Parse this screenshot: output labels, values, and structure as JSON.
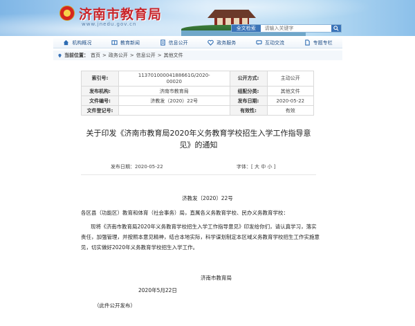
{
  "header": {
    "site_title": "济南市教育局",
    "site_domain": "www.jnedu.gov.cn",
    "search_label": "全文检索",
    "search_placeholder": "请输入关键字"
  },
  "nav": {
    "items": [
      {
        "label": "机构概况",
        "icon": "home-icon"
      },
      {
        "label": "教育新闻",
        "icon": "book-icon"
      },
      {
        "label": "信息公开",
        "icon": "document-icon"
      },
      {
        "label": "政务服务",
        "icon": "heart-icon"
      },
      {
        "label": "互动交流",
        "icon": "chat-icon"
      },
      {
        "label": "专题专栏",
        "icon": "file-icon"
      }
    ]
  },
  "breadcrumb": {
    "prefix": "当前位置：",
    "items": [
      "首页",
      "政务公开",
      "信息公开",
      "其他文件"
    ],
    "separator": ">"
  },
  "meta": {
    "index_label": "索引号:",
    "index_value_1": "11370100004188661G/2020-",
    "index_value_2": "00020",
    "open_mode_label": "公开方式:",
    "open_mode_value": "主动公开",
    "issuer_label": "发布机构:",
    "issuer_value": "济南市教育局",
    "category_label": "组配分类:",
    "category_value": "其他文件",
    "doc_no_label": "文件编号:",
    "doc_no_value": "济教发（2020）22号",
    "date_label": "发布日期:",
    "date_value": "2020-05-22",
    "reg_label": "文件登记号:",
    "reg_value": "",
    "validity_label": "有效性:",
    "validity_value": "有效"
  },
  "article": {
    "title_line1": "关于印发《济南市教育局2020年义务教育学校招生入学工作指导意",
    "title_line2": "见》的通知",
    "pub_date_label": "发布日期：",
    "pub_date": "2020-05-22",
    "font_label": "字体：[",
    "font_large": "大",
    "font_medium": "中",
    "font_small": "小",
    "font_close": "]",
    "doc_no": "济教发〔2020〕22号",
    "addressee": "各区县（功能区）教育和体育（社会事务）局，直属各义务教育学校、民办义务教育学校：",
    "body": "现将《济南市教育局2020年义务教育学校招生入学工作指导意见》印发给你们，请认真学习，落实责任，加强管理，并按照本意见精神，结合本地实际，科学谋划制定本区域义务教育学校招生工作实施意见，切实做好2020年义务教育学校招生入学工作。",
    "issuer": "济南市教育局",
    "sign_date": "2020年5月22日",
    "note": "（此件公开发布）"
  },
  "colors": {
    "title_red": "#c8242a",
    "nav_blue": "#1f4e86",
    "search_blue": "#3a74b8"
  }
}
